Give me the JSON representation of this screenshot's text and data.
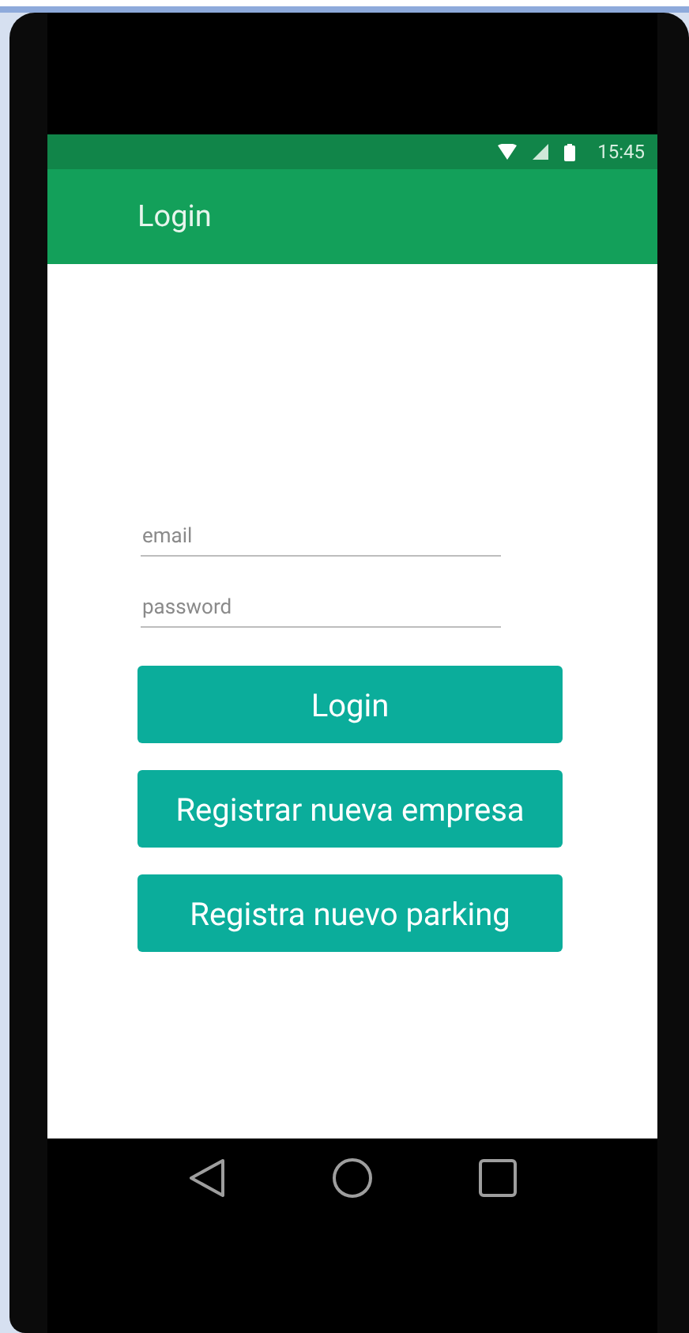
{
  "status_bar": {
    "time": "15:45"
  },
  "app_bar": {
    "title": "Login"
  },
  "fields": [
    {
      "placeholder": "email"
    },
    {
      "placeholder": "password"
    }
  ],
  "buttons": [
    "Login",
    "Registrar nueva empresa",
    "Registra nuevo parking"
  ]
}
